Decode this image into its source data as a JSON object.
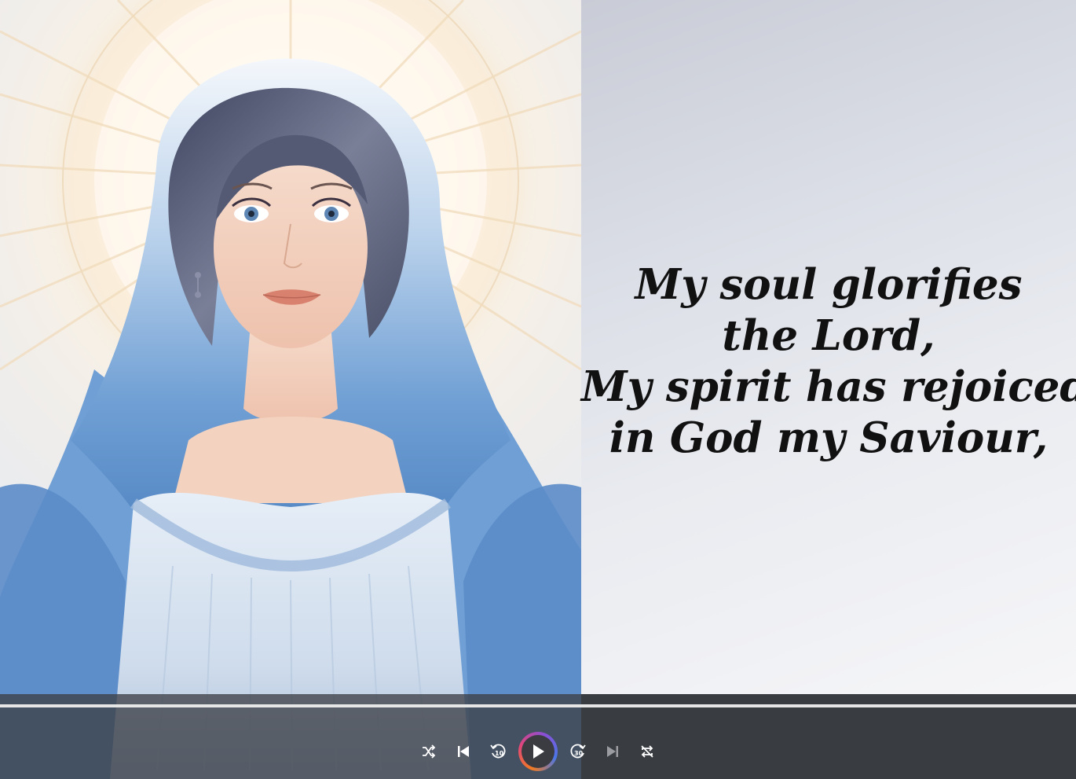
{
  "lyrics": {
    "lines": [
      "My soul glorifies",
      "the Lord,",
      "My spirit has rejoiced",
      "in God my Saviour,"
    ]
  },
  "player": {
    "progress": 1.0,
    "skip_back_seconds": "10",
    "skip_forward_seconds": "30",
    "colors": {
      "bar": "#3e4046",
      "icon": "#ffffff",
      "icon_disabled": "#9a9ca2",
      "ring_start": "#f07a22",
      "ring_end": "#8a4fd6"
    },
    "icons": {
      "shuffle": "shuffle-icon",
      "previous": "previous-track-icon",
      "rewind": "rewind-10-icon",
      "play": "play-icon",
      "forward": "forward-30-icon",
      "next": "next-track-icon",
      "repeat": "repeat-off-icon"
    }
  },
  "artwork": {
    "subject": "madonna-portrait",
    "colors": {
      "halo": "#fff6e6",
      "veil": "#6f9fd4",
      "veil_light": "#a9c6e8",
      "hair": "#5a5f78",
      "skin": "#f3d2bf",
      "dress": "#d9e5f2"
    }
  }
}
